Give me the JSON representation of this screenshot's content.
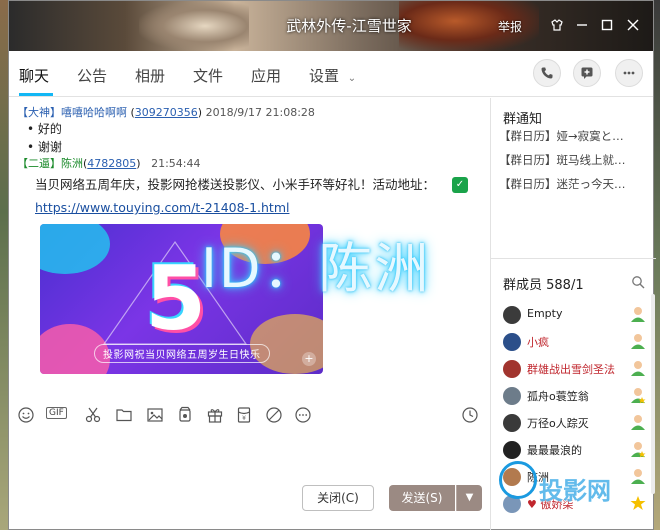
{
  "window": {
    "title": "武林外传-江雪世家",
    "report_label": "举报"
  },
  "tabs": [
    {
      "label": "聊天"
    },
    {
      "label": "公告"
    },
    {
      "label": "相册"
    },
    {
      "label": "文件"
    },
    {
      "label": "应用"
    },
    {
      "label": "设置"
    }
  ],
  "header_actions": [
    "phone-icon",
    "add-message-icon",
    "more-icon"
  ],
  "messages": [
    {
      "tag": "【大神】",
      "sender": "嘻嘻哈哈啊啊",
      "qq": "309270356",
      "time": "2018/9/17 21:08:28",
      "lines": [
        "好的",
        "谢谢"
      ]
    },
    {
      "tag": "【二逼】",
      "sender": "陈洲",
      "qq": "4782805",
      "time": "21:54:44",
      "text": "当贝网络五周年庆，投影网抢楼送投影仪、小米手环等好礼！活动地址：",
      "link": "https://www.touying.com/t-21408-1.html"
    }
  ],
  "banner": {
    "number": "5",
    "caption": "投影网祝当贝网络五周岁生日快乐"
  },
  "overlay_text": "ID：陈洲",
  "toolbar": {
    "gif_label": "GIF"
  },
  "buttons": {
    "close": "关闭(C)",
    "send": "发送(S)"
  },
  "notice": {
    "title": "群通知",
    "items": [
      "【群日历】娅→寂寞と…",
      "【群日历】斑马线上就…",
      "【群日历】迷茫っ今天…"
    ]
  },
  "members": {
    "title": "群成员 588/1",
    "list": [
      {
        "name": "Empty",
        "color": "#222222"
      },
      {
        "name": "小疯",
        "color": "#c0262d"
      },
      {
        "name": "群雄战出雪剑圣法",
        "color": "#c0262d"
      },
      {
        "name": "孤舟o蓑笠翁",
        "color": "#222222"
      },
      {
        "name": "万径o人踪灭",
        "color": "#222222"
      },
      {
        "name": "最最最浪的",
        "color": "#222222"
      },
      {
        "name": "陈洲",
        "color": "#222222"
      },
      {
        "name": "♥ 傲娇柒",
        "color": "#c0262d"
      }
    ]
  },
  "watermark": "投影网",
  "colors": {
    "accent": "#12b7f5",
    "link": "#1a4fa0",
    "tag_blue": "#2a5fb0",
    "tag_green": "#1a8a2a",
    "send_button": "#9b8a83"
  }
}
